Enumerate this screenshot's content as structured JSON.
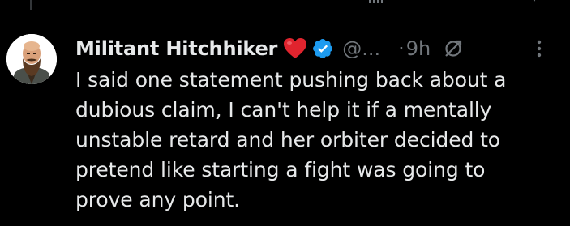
{
  "tweet": {
    "display_name": "Militant Hitchhiker",
    "handle": "@...",
    "separator": "·",
    "time": "9h",
    "text_lines": [
      "I said one statement pushing back about a",
      "dubious claim, I can't help it if a mentally",
      "unstable retard and her orbiter decided to",
      "pretend like starting a fight was going to",
      "prove any point."
    ]
  },
  "icons": {
    "heart": "red-heart-emoji",
    "verified": "verified-badge-icon",
    "edited": "edited-pencil-icon",
    "more": "more-options-icon"
  },
  "colors": {
    "background": "#000000",
    "text": "#e7e9ea",
    "secondary_text": "#71767b",
    "verified_blue": "#1d9bf0",
    "heart_red": "#e0242e"
  }
}
